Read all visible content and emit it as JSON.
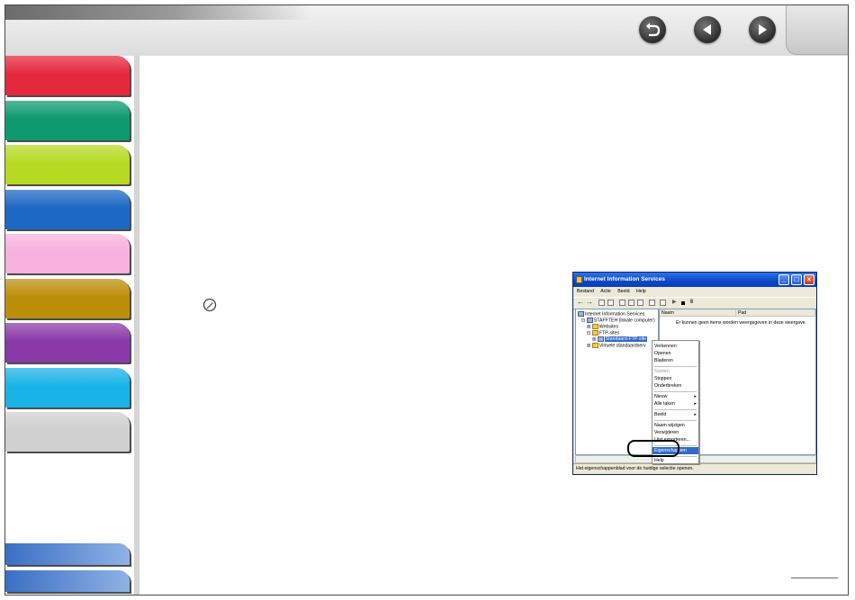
{
  "nav": {
    "back_icon": "return-arrow-icon",
    "prev_icon": "triangle-left-icon",
    "next_icon": "triangle-right-icon"
  },
  "sidebar": {
    "tabs": [
      {
        "color": "#e6283c"
      },
      {
        "color": "#0e9a6e"
      },
      {
        "color": "#b6da22"
      },
      {
        "color": "#1c68c4"
      },
      {
        "color": "#f8b0de"
      },
      {
        "color": "#bc8f0a"
      },
      {
        "color": "#8a3aa8"
      },
      {
        "color": "#1ab3e8"
      },
      {
        "color": "#d0d0d0"
      }
    ]
  },
  "screenshot": {
    "title": "Internet Information Services",
    "menu": [
      "Bestand",
      "Actie",
      "Beeld",
      "Help"
    ],
    "tree": {
      "root": "Internet Information Services",
      "computer": "STAFFTEH (lokale computer)",
      "websites": "Websites",
      "ftp_sites": "FTP-sites",
      "default_ftp": "Standaard-FTP-site",
      "virtual_servers": "Virtuele standaardserv"
    },
    "columns": {
      "name": "Naam",
      "path": "Pad"
    },
    "empty_message": "Er kunnen geen items worden weergegeven in deze weergave.",
    "context_menu": {
      "explore": "Verkennen",
      "open": "Openen",
      "browse": "Bladeren",
      "start": "Starten",
      "stop": "Stoppen",
      "pause": "Onderbreken",
      "new": "Nieuw",
      "all_tasks": "Alle taken",
      "view": "Beeld",
      "rename": "Naam wijzigen",
      "delete": "Verwijderen",
      "export_list": "Lijst exporteren...",
      "properties": "Eigenschappen",
      "help": "Help"
    },
    "status": "Het eigenschappenblad voor de huidige selectie openen."
  }
}
